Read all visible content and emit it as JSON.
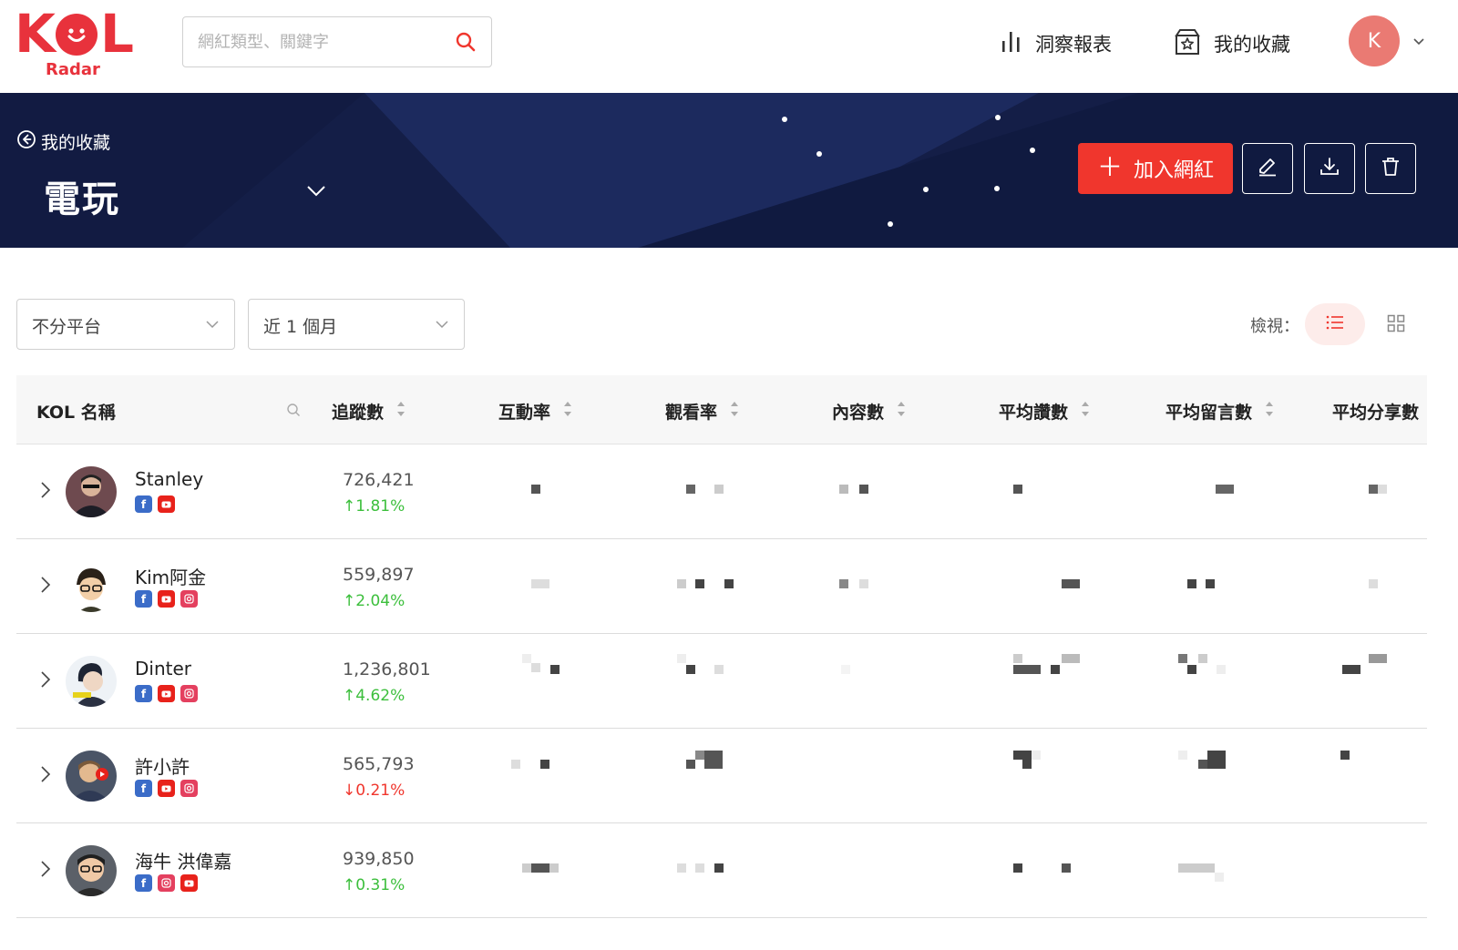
{
  "brand": {
    "logo_text": "KOL",
    "logo_sub": "Radar",
    "accent": "#f0362d",
    "navy": "#141e47"
  },
  "search": {
    "placeholder": "網紅類型、關鍵字",
    "value": ""
  },
  "nav": {
    "insight": "洞察報表",
    "favorites": "我的收藏",
    "user_initial": "K"
  },
  "banner": {
    "back_label": "我的收藏",
    "collection_title": "電玩",
    "add_button": "加入網紅"
  },
  "filters": {
    "platform": "不分平台",
    "period": "近 1 個月",
    "view_label": "檢視："
  },
  "table": {
    "columns": [
      "KOL 名稱",
      "追蹤數",
      "互動率",
      "觀看率",
      "內容數",
      "平均讚數",
      "平均留言數",
      "平均分享數"
    ],
    "rows": [
      {
        "name": "Stanley",
        "platforms": [
          "facebook",
          "youtube"
        ],
        "followers": "726,421",
        "growth": "↑1.81%",
        "trend": "up"
      },
      {
        "name": "Kim阿金",
        "platforms": [
          "facebook",
          "youtube",
          "instagram"
        ],
        "followers": "559,897",
        "growth": "↑2.04%",
        "trend": "up"
      },
      {
        "name": "Dinter",
        "platforms": [
          "facebook",
          "youtube",
          "instagram"
        ],
        "followers": "1,236,801",
        "growth": "↑4.62%",
        "trend": "up"
      },
      {
        "name": "許小許",
        "platforms": [
          "facebook",
          "youtube",
          "instagram"
        ],
        "followers": "565,793",
        "growth": "↓0.21%",
        "trend": "down"
      },
      {
        "name": "海牛 洪偉嘉",
        "platforms": [
          "facebook",
          "instagram",
          "youtube"
        ],
        "followers": "939,850",
        "growth": "↑0.31%",
        "trend": "up"
      }
    ]
  }
}
